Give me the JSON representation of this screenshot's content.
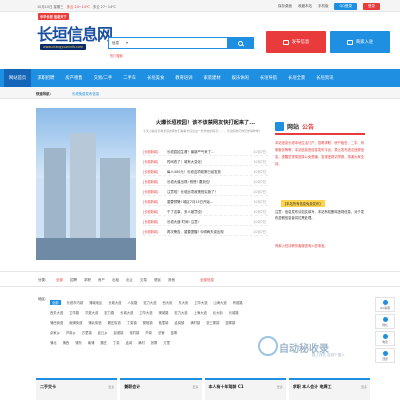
{
  "topbar": {
    "date": "10月10日 星期三",
    "weather": "多云 24~14℃",
    "weather2": "多云 27~14℃",
    "links": [
      "保存桌面",
      "收藏本站",
      "手机版"
    ],
    "qq_login": "QQ登录",
    "login": "登录"
  },
  "logo": {
    "tag": "中华长垣 信息天下",
    "title": "长垣信息网",
    "url": "www.changyuaninfo.com"
  },
  "search": {
    "type": "信息",
    "placeholder": "",
    "hot": "热门搜索"
  },
  "header_buttons": {
    "publish": "发布信息",
    "job": "商家入驻"
  },
  "nav": {
    "items": [
      "网站首页",
      "求职招聘",
      "房产租售",
      "交易/二手",
      "二手车",
      "长垣美食",
      "教育培训",
      "家装建材",
      "娱乐休闲",
      "长垣导航",
      "长垣全景",
      "长垣资讯"
    ]
  },
  "quick": {
    "label": "快速导航：",
    "value": "长垣免费发布信息"
  },
  "news": {
    "headline": "火爆长垣校园！该不该禁网友快打起来了...",
    "desc": "今天小编就带着长垣的网友们看看长垣这边一所学校的情况……，长垣网友们你们觉得咋样？",
    "items": [
      {
        "cat": "[长垣新闻]",
        "title": "长垣县招生遭！最新严气来了…",
        "date": "10月7日"
      },
      {
        "cat": "[长垣新闻]",
        "title": "时间改了！城有大变化！",
        "date": "10月7日"
      },
      {
        "cat": "[长垣新闻]",
        "title": "每人400元！长垣这项政策已经发放",
        "date": "10月7日"
      },
      {
        "cat": "[长垣新闻]",
        "title": "长垣大道出现! 别慌! 要到位!",
        "date": "10月7日"
      },
      {
        "cat": "[长垣新闻]",
        "title": "注意啦！长垣此项政策快实施了！",
        "date": "10月7日"
      },
      {
        "cat": "[长垣新闻]",
        "title": "重要预警! 城区7月15日开始…",
        "date": "10月7日"
      },
      {
        "cat": "[长垣新闻]",
        "title": "千了这事，多人被罚没！",
        "date": "10月7日"
      },
      {
        "cat": "[长垣新闻]",
        "title": "长垣大道 时间! 注意!",
        "date": "10月7日"
      },
      {
        "cat": "[长垣新闻]",
        "title": "再次警告，重要提醒! 今明两天或出现",
        "date": "10月7日"
      }
    ]
  },
  "notice": {
    "title1": "网站",
    "title2": "公告",
    "body": "本站信息长垣本地生活门户，招聘求职、房产租售、二手、商家服务等等，本站信息是信息发布平台，禁止发布违法违规信息，提醒您谨慎选择以免受骗，发现违规请举报，感谢大家支持。",
    "link": "【本站所有信息免费发布】",
    "body2": "注意：信息发布请如实填写，本站有权删除违规信息，对于发布虚假信息者将拉黑处理。",
    "wait": "商家入驻请联系客服咨询入驻事宜。"
  },
  "floaters": [
    "QQ客服",
    "微信",
    "电话",
    "顶部"
  ],
  "filter": {
    "label": "分类:",
    "options": [
      "全部",
      "招聘",
      "求职",
      "房产",
      "出租",
      "出让",
      "交易",
      "便民",
      "其他"
    ],
    "active": "全部",
    "sub": "全部信息"
  },
  "region": {
    "label": "地区:",
    "rows": [
      [
        "全部",
        "长垣市内城",
        "蒲城地区",
        "长城大道",
        "人民路",
        "宏力大道",
        "西大街",
        "东大街",
        "卫华大道",
        "山海大道",
        "有德路"
      ],
      [
        "西关大道",
        "卫华路",
        "华夏大道",
        "宏力路",
        "长城大道",
        "卫华大道",
        "蒲城路",
        "宏力大道",
        "上海大道",
        "北大街",
        "长城路"
      ],
      [
        "蒲西街道",
        "南蒲街道",
        "蒲北街道",
        "魏庄街道",
        "丁栾镇",
        "樊相镇",
        "恼里镇",
        "孟岗镇",
        "满村镇",
        "张三寨镇",
        "苗寨镇"
      ],
      [
        "佘家乡",
        "芦岗乡",
        "方里镇",
        "武丘乡",
        "赵堤镇",
        "常村镇",
        "芦岗",
        "总管",
        "苗寨"
      ],
      [
        "蒲北",
        "蒲西",
        "蒲东",
        "南蒲",
        "魏庄",
        "丁栾",
        "孟岗",
        "满村",
        "张寨",
        "方里"
      ]
    ]
  },
  "watermark": {
    "text": "自动秘收录",
    "sub": "数上排名 自然个搜人"
  },
  "columns": [
    {
      "title": "二手交卡",
      "more": "更多"
    },
    {
      "title": "兼职会计",
      "more": "更多"
    },
    {
      "title": "本人有十年驾龄 C1",
      "more": "更多"
    },
    {
      "title": "求职 本人会计 电焊工",
      "more": "更多"
    }
  ]
}
